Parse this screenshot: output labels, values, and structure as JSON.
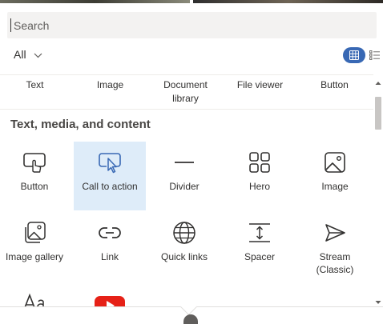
{
  "search": {
    "placeholder": "Search"
  },
  "filter": {
    "label": "All"
  },
  "top_row": [
    "Text",
    "Image",
    "Document\nlibrary",
    "File viewer",
    "Button"
  ],
  "section": {
    "title": "Text, media, and content"
  },
  "tiles": [
    {
      "label": "Button",
      "icon": "button-icon"
    },
    {
      "label": "Call to action",
      "icon": "call-to-action-icon",
      "selected": true
    },
    {
      "label": "Divider",
      "icon": "divider-icon"
    },
    {
      "label": "Hero",
      "icon": "hero-icon"
    },
    {
      "label": "Image",
      "icon": "image-icon"
    },
    {
      "label": "Image gallery",
      "icon": "image-gallery-icon"
    },
    {
      "label": "Link",
      "icon": "link-icon"
    },
    {
      "label": "Quick links",
      "icon": "globe-icon"
    },
    {
      "label": "Spacer",
      "icon": "spacer-icon"
    },
    {
      "label": "Stream\n(Classic)",
      "icon": "stream-icon"
    }
  ],
  "colors": {
    "accent": "#3868b4",
    "selected_bg": "#deecf9",
    "youtube": "#e62117"
  }
}
